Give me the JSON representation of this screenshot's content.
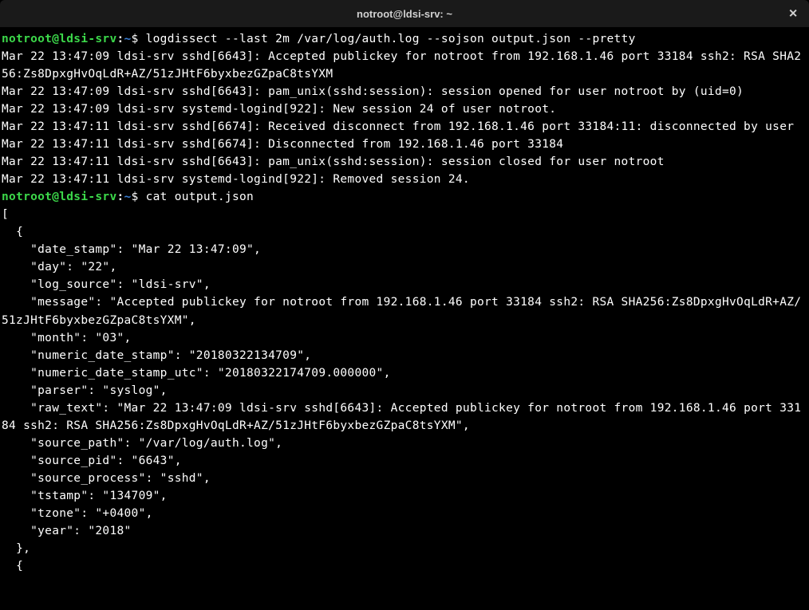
{
  "window": {
    "title": "notroot@ldsi-srv: ~"
  },
  "prompt": {
    "user_host": "notroot@ldsi-srv",
    "colon": ":",
    "path": "~",
    "dollar": "$ "
  },
  "commands": {
    "c1": "logdissect --last 2m /var/log/auth.log --sojson output.json --pretty",
    "c2": "cat output.json"
  },
  "output1": {
    "l1": "Mar 22 13:47:09 ldsi-srv sshd[6643]: Accepted publickey for notroot from 192.168.1.46 port 33184 ssh2: RSA SHA256:Zs8DpxgHvOqLdR+AZ/51zJHtF6byxbezGZpaC8tsYXM",
    "l2": "Mar 22 13:47:09 ldsi-srv sshd[6643]: pam_unix(sshd:session): session opened for user notroot by (uid=0)",
    "l3": "Mar 22 13:47:09 ldsi-srv systemd-logind[922]: New session 24 of user notroot.",
    "l4": "Mar 22 13:47:11 ldsi-srv sshd[6674]: Received disconnect from 192.168.1.46 port 33184:11: disconnected by user",
    "l5": "Mar 22 13:47:11 ldsi-srv sshd[6674]: Disconnected from 192.168.1.46 port 33184",
    "l6": "Mar 22 13:47:11 ldsi-srv sshd[6643]: pam_unix(sshd:session): session closed for user notroot",
    "l7": "Mar 22 13:47:11 ldsi-srv systemd-logind[922]: Removed session 24."
  },
  "output2": {
    "l1": "[",
    "l2": "  {",
    "l3": "    \"date_stamp\": \"Mar 22 13:47:09\",",
    "l4": "    \"day\": \"22\",",
    "l5": "    \"log_source\": \"ldsi-srv\",",
    "l6": "    \"message\": \"Accepted publickey for notroot from 192.168.1.46 port 33184 ssh2: RSA SHA256:Zs8DpxgHvOqLdR+AZ/51zJHtF6byxbezGZpaC8tsYXM\",",
    "l7": "    \"month\": \"03\",",
    "l8": "    \"numeric_date_stamp\": \"20180322134709\",",
    "l9": "    \"numeric_date_stamp_utc\": \"20180322174709.000000\",",
    "l10": "    \"parser\": \"syslog\",",
    "l11": "    \"raw_text\": \"Mar 22 13:47:09 ldsi-srv sshd[6643]: Accepted publickey for notroot from 192.168.1.46 port 33184 ssh2: RSA SHA256:Zs8DpxgHvOqLdR+AZ/51zJHtF6byxbezGZpaC8tsYXM\",",
    "l12": "    \"source_path\": \"/var/log/auth.log\",",
    "l13": "    \"source_pid\": \"6643\",",
    "l14": "    \"source_process\": \"sshd\",",
    "l15": "    \"tstamp\": \"134709\",",
    "l16": "    \"tzone\": \"+0400\",",
    "l17": "    \"year\": \"2018\"",
    "l18": "  },",
    "l19": "  {"
  }
}
